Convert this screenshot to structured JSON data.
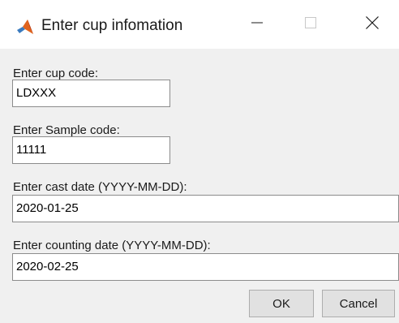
{
  "window": {
    "title": "Enter cup infomation",
    "app_icon": "matlab-icon",
    "minimize_icon": "minimize-icon",
    "maximize_icon": "maximize-icon",
    "close_icon": "close-icon"
  },
  "form": {
    "fields": [
      {
        "label": "Enter cup code:",
        "value": "LDXXX"
      },
      {
        "label": "Enter Sample code:",
        "value": "11111"
      },
      {
        "label": "Enter cast date (YYYY-MM-DD):",
        "value": "2020-01-25"
      },
      {
        "label": "Enter counting date (YYYY-MM-DD):",
        "value": "2020-02-25"
      }
    ]
  },
  "buttons": {
    "ok_label": "OK",
    "cancel_label": "Cancel"
  },
  "colors": {
    "titlebar_bg": "#ffffff",
    "dialog_bg": "#f0f0f0",
    "field_border": "#8c8c8c",
    "button_bg": "#e1e1e1"
  }
}
